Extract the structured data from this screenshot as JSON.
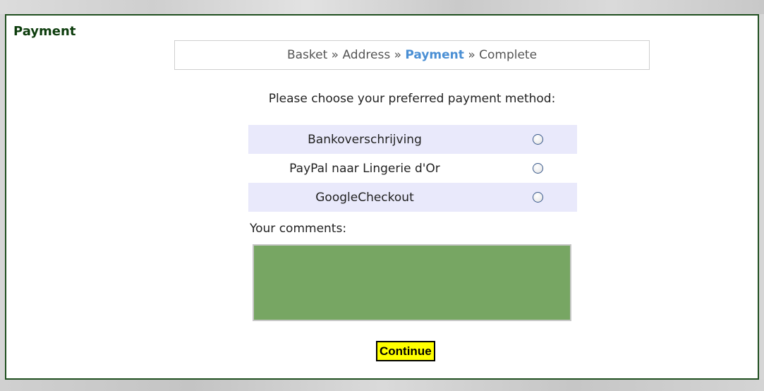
{
  "page": {
    "title": "Payment"
  },
  "steps": {
    "basket": "Basket",
    "address": "Address",
    "payment": "Payment",
    "complete": "Complete",
    "separator": "»"
  },
  "prompt": "Please choose your preferred payment method:",
  "payment_methods": [
    {
      "label": "Bankoverschrijving",
      "selected": false
    },
    {
      "label": "PayPal naar Lingerie d'Or",
      "selected": false
    },
    {
      "label": "GoogleCheckout",
      "selected": false
    }
  ],
  "comments": {
    "label": "Your comments:",
    "value": ""
  },
  "continue_label": "Continue",
  "colors": {
    "title": "#0d3d0d",
    "active_step": "#4a8fd4",
    "row_shade": "#e9e9fb",
    "comments_bg": "#77a663",
    "button_bg": "#ffff00"
  }
}
